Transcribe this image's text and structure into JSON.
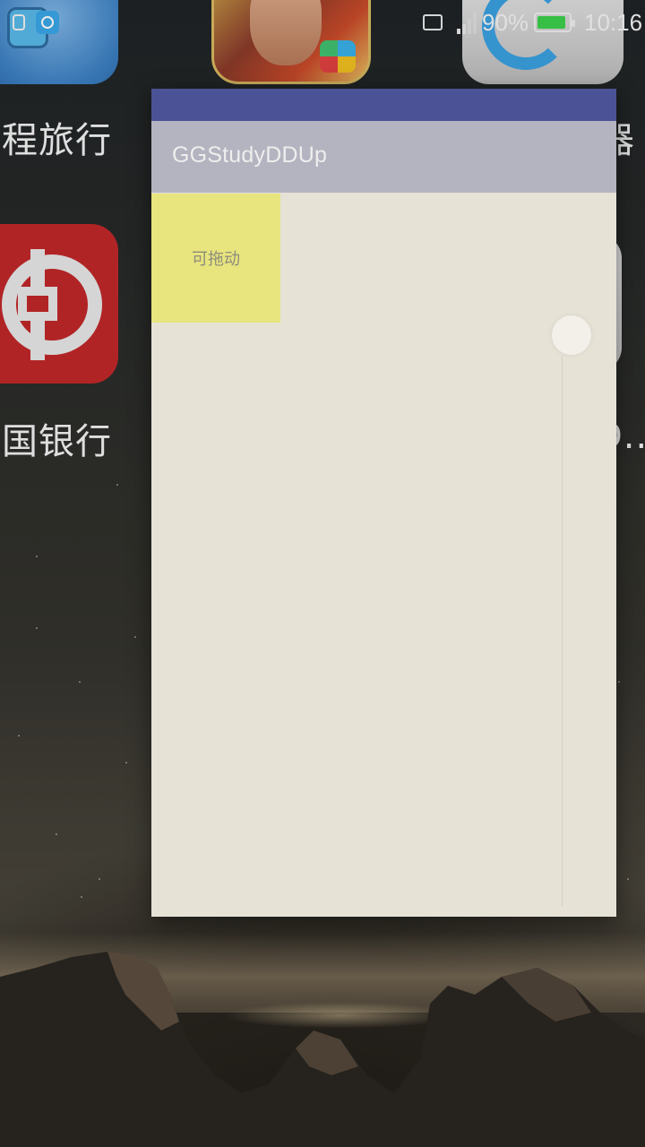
{
  "status_bar": {
    "battery_percent": "90%",
    "battery_level": 0.9,
    "time": "10:16",
    "icons": [
      "notification-lock-icon",
      "notification-app-icon",
      "cast-icon",
      "signal-icon",
      "battery-icon"
    ]
  },
  "home_screen": {
    "labels": {
      "ctrip": "程旅行",
      "boc": "国银行",
      "right_top": "器",
      "right_bottom": "D.."
    },
    "icons": [
      "ctrip-app-icon",
      "game-app-icon",
      "qq-browser-app-icon",
      "bank-of-china-app-icon",
      "partial-app-icon"
    ]
  },
  "app": {
    "title": "GGStudyDDUp",
    "draggable_label": "可拖动",
    "colors": {
      "status_bar": "#4b5396",
      "toolbar": "#b4b3c0",
      "background": "#e6e2d6",
      "draggable": "#e8e47e"
    }
  }
}
